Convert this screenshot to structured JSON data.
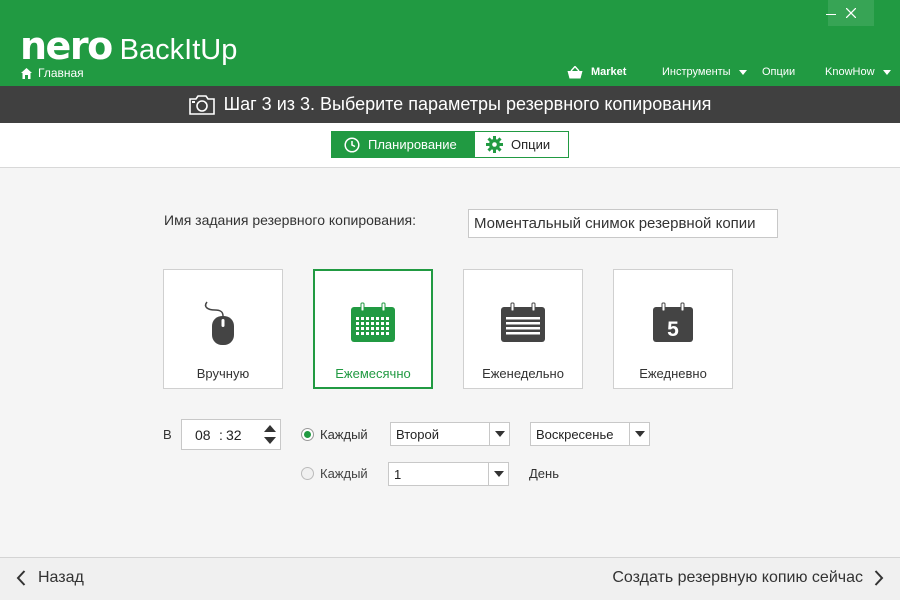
{
  "app": {
    "logo_brand": "nero",
    "logo_product": "BackItUp",
    "home_label": "Главная",
    "accent_color": "#219a42"
  },
  "window_controls": {
    "minimize_icon": "minimize-icon",
    "close_label": "✕"
  },
  "topnav": {
    "market": "Market",
    "tools": "Инструменты",
    "options": "Опции",
    "knowhow": "KnowHow"
  },
  "step": {
    "title": "Шаг 3 из 3. Выберите параметры резервного копирования",
    "icon": "camera-icon"
  },
  "tabs": [
    {
      "label": "Планирование",
      "icon": "clock-icon",
      "active": true
    },
    {
      "label": "Опции",
      "icon": "gear-icon",
      "active": false
    }
  ],
  "job": {
    "label": "Имя задания резервного копирования:",
    "value": "Моментальный снимок резервной копии"
  },
  "schedule_cards": [
    {
      "label": "Вручную",
      "icon": "mouse-icon",
      "selected": false
    },
    {
      "label": "Ежемесячно",
      "icon": "calendar-month-icon",
      "selected": true
    },
    {
      "label": "Еженедельно",
      "icon": "calendar-week-icon",
      "selected": false
    },
    {
      "label": "Ежедневно",
      "icon": "calendar-day-icon",
      "selected": false
    }
  ],
  "daily_icon_number": "5",
  "time": {
    "label": "В",
    "hours": "08",
    "separator": ":",
    "minutes": "32"
  },
  "option1": {
    "label": "Каждый",
    "selected": true,
    "week_value": "Второй",
    "day_value": "Воскресенье"
  },
  "option2": {
    "label": "Каждый",
    "selected": false,
    "number_value": "1",
    "unit": "День"
  },
  "footer": {
    "back": "Назад",
    "create": "Создать резервную копию сейчас"
  }
}
